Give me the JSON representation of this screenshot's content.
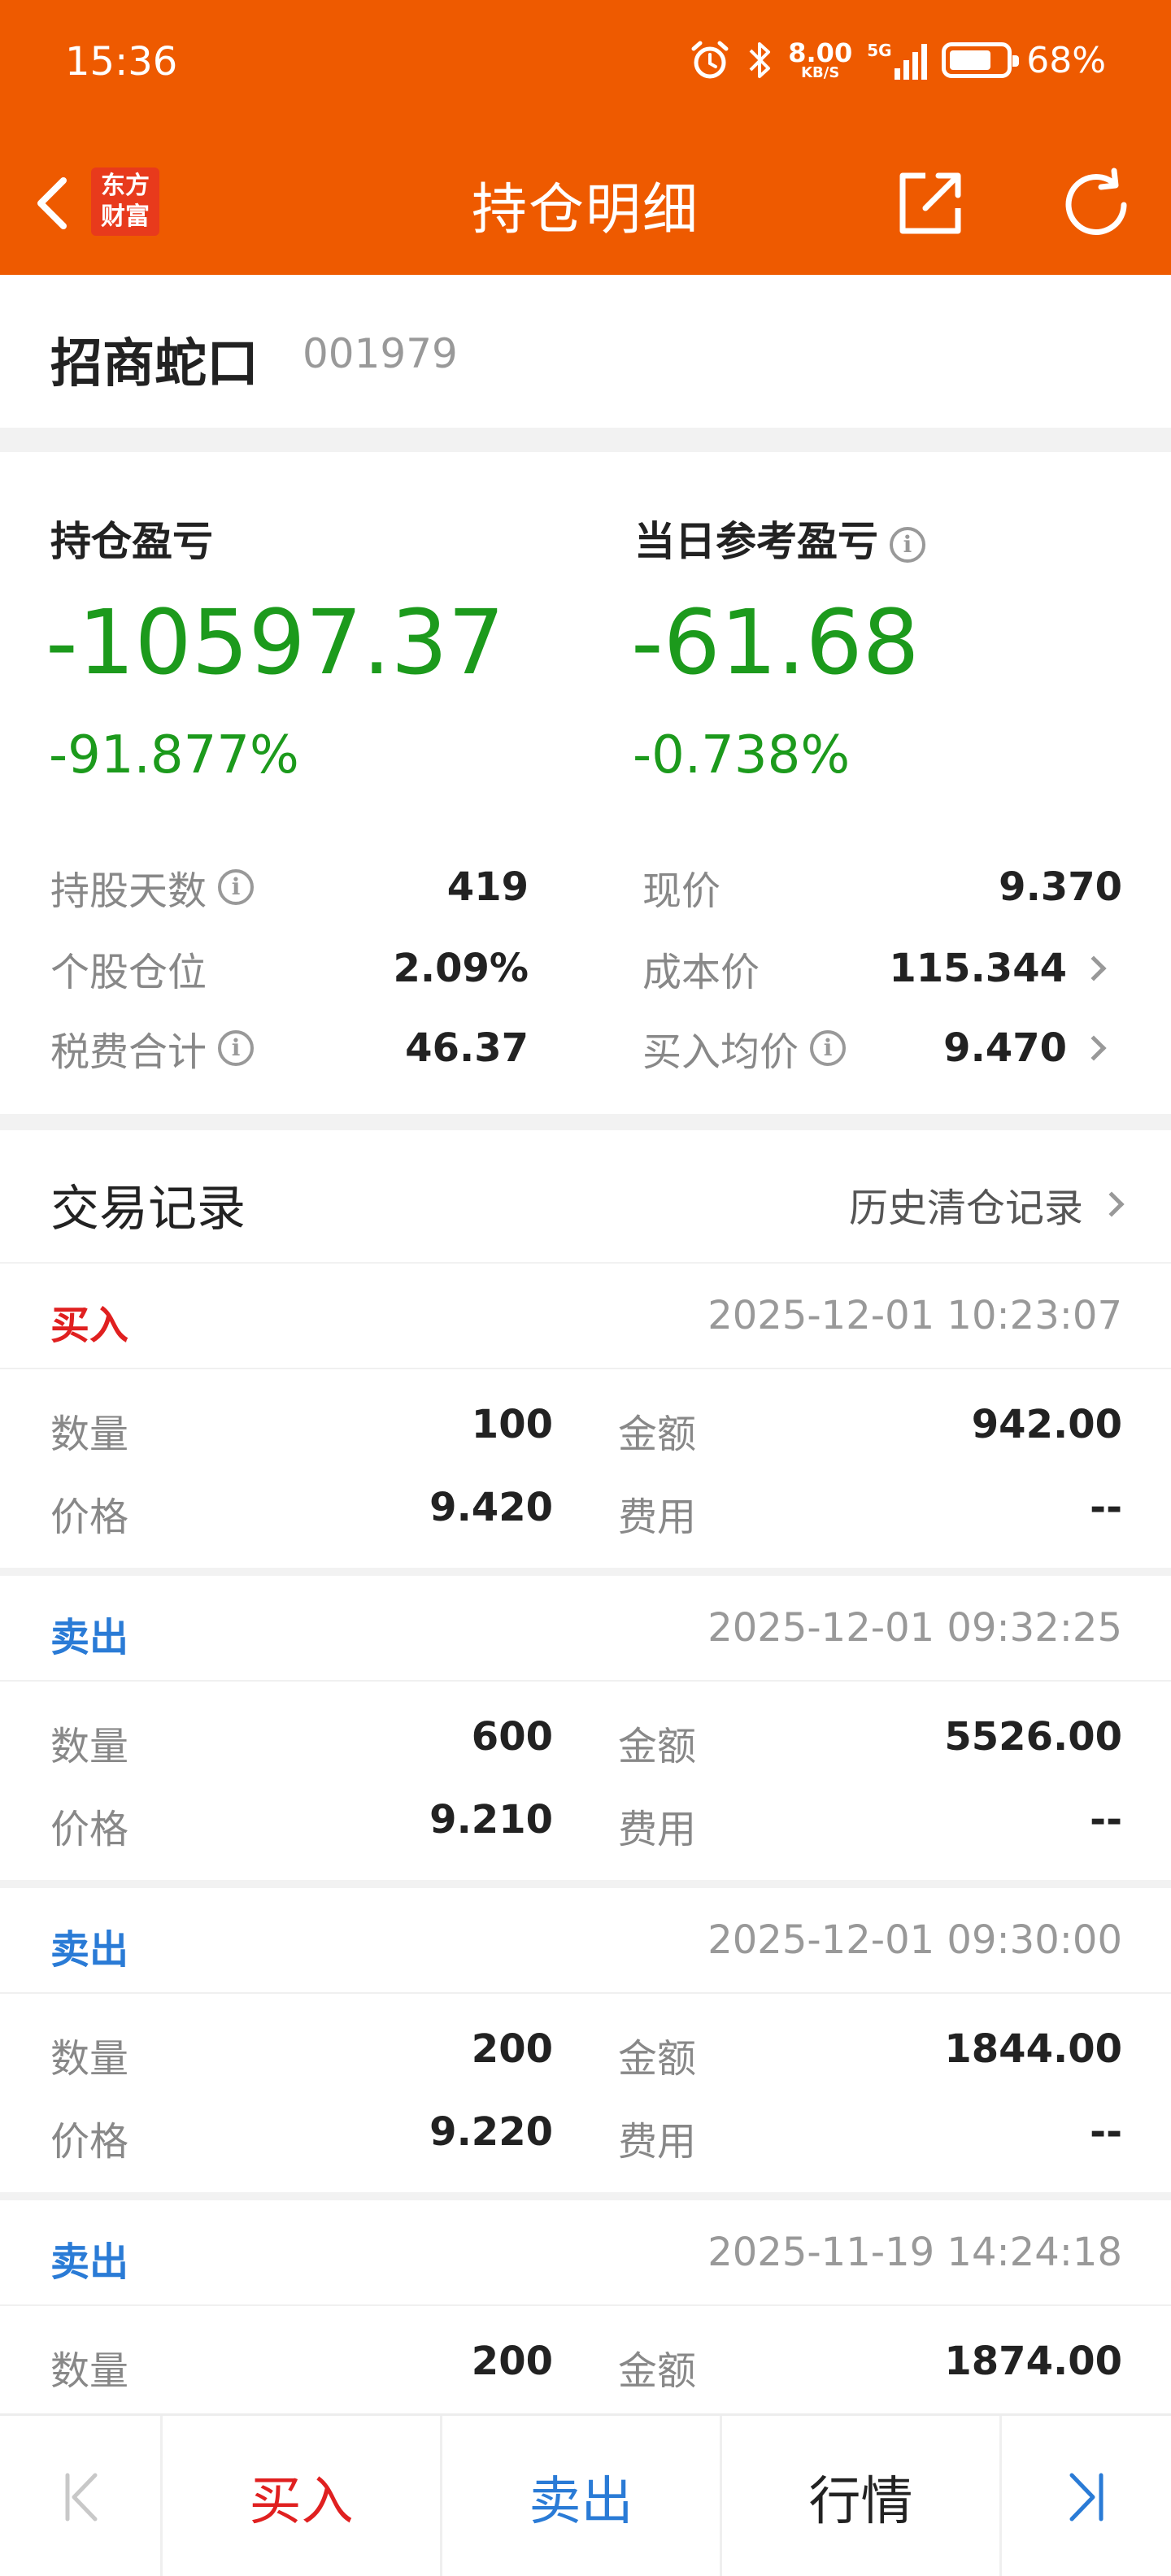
{
  "status": {
    "time": "15:36",
    "net_speed": "8.00",
    "net_unit": "KB/S",
    "network": "5G",
    "battery": "68%"
  },
  "nav": {
    "title": "持仓明细",
    "logo_line1": "东方",
    "logo_line2": "财富"
  },
  "stock": {
    "name": "招商蛇口",
    "code": "001979"
  },
  "pl": {
    "hold_label": "持仓盈亏",
    "hold_value": "-10597.37",
    "hold_pct": "-91.877%",
    "day_label": "当日参考盈亏",
    "day_value": "-61.68",
    "day_pct": "-0.738%"
  },
  "details": [
    {
      "key": "持股天数",
      "value": "419",
      "info": true
    },
    {
      "key": "个股仓位",
      "value": "2.09%"
    },
    {
      "key": "税费合计",
      "value": "46.37",
      "info": true
    },
    {
      "key": "现价",
      "value": "9.370"
    },
    {
      "key": "成本价",
      "value": "115.344",
      "chevron": true
    },
    {
      "key": "买入均价",
      "value": "9.470",
      "info": true,
      "chevron": true
    }
  ],
  "records_section": {
    "title": "交易记录",
    "history_link": "历史清仓记录"
  },
  "labels": {
    "qty": "数量",
    "amount": "金额",
    "price": "价格",
    "fee": "费用"
  },
  "records": [
    {
      "type": "买入",
      "time": "2025-12-01 10:23:07",
      "qty": "100",
      "amount": "942.00",
      "price": "9.420",
      "fee": "--"
    },
    {
      "type": "卖出",
      "time": "2025-12-01 09:32:25",
      "qty": "600",
      "amount": "5526.00",
      "price": "9.210",
      "fee": "--"
    },
    {
      "type": "卖出",
      "time": "2025-12-01 09:30:00",
      "qty": "200",
      "amount": "1844.00",
      "price": "9.220",
      "fee": "--"
    },
    {
      "type": "卖出",
      "time": "2025-11-19 14:24:18",
      "qty": "200",
      "amount": "1874.00"
    }
  ],
  "bottom": {
    "buy": "买入",
    "sell": "卖出",
    "market": "行情"
  },
  "colors": {
    "brand": "#ee5a00",
    "loss_green": "#1c9a1c",
    "buy_red": "#e02020",
    "sell_blue": "#2a7bd6"
  }
}
